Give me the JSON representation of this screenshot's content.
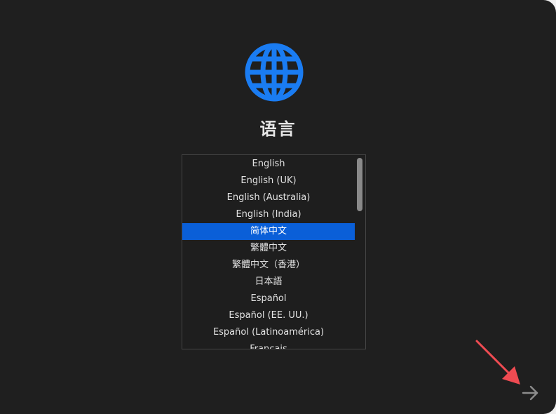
{
  "title": "语言",
  "languages": [
    "English",
    "English (UK)",
    "English (Australia)",
    "English (India)",
    "简体中文",
    "繁體中文",
    "繁體中文（香港）",
    "日本語",
    "Español",
    "Español (EE. UU.)",
    "Español (Latinoamérica)",
    "Français"
  ],
  "selected_language": "简体中文",
  "icons": {
    "header": "globe-icon",
    "continue": "arrow-right-icon",
    "annotation": "annotation-arrow"
  },
  "colors": {
    "background": "#1f1f1f",
    "accent": "#1a7cf2",
    "selection": "#0a5fd8",
    "text": "#e2e2e2",
    "annotation": "#ef4b52"
  }
}
